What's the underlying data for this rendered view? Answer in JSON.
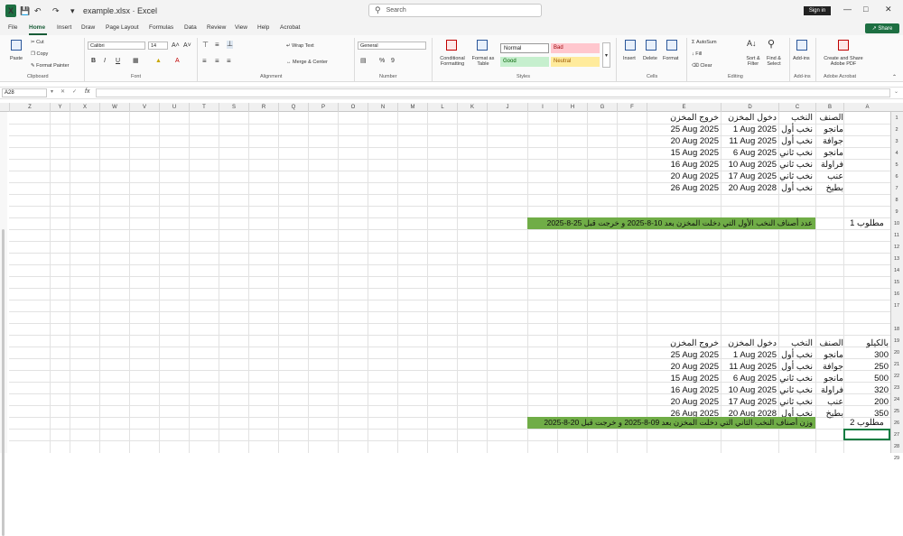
{
  "titlebar": {
    "app_icon": "X",
    "doc_title": "example.xlsx · Excel",
    "search_placeholder": "Search",
    "sign_in": "Sign in"
  },
  "menubar": {
    "tabs": [
      "File",
      "Home",
      "Insert",
      "Draw",
      "Page Layout",
      "Formulas",
      "Data",
      "Review",
      "View",
      "Help",
      "Acrobat"
    ],
    "share": "Share"
  },
  "ribbon": {
    "paste": "Paste",
    "cut": "Cut",
    "copy": "Copy",
    "format_painter": "Format Painter",
    "clipboard": "Clipboard",
    "font_name": "Calibri",
    "font_size": "14",
    "font_group": "Font",
    "wrap_text": "Wrap Text",
    "merge_center": "Merge & Center",
    "alignment": "Alignment",
    "number_format": "General",
    "number_group": "Number",
    "conditional": "Conditional Formatting",
    "format_table": "Format as Table",
    "style_normal": "Normal",
    "style_bad": "Bad",
    "style_good": "Good",
    "style_neutral": "Neutral",
    "styles_group": "Styles",
    "insert": "Insert",
    "delete": "Delete",
    "format": "Format",
    "cells_group": "Cells",
    "autosum": "AutoSum",
    "fill": "Fill",
    "clear": "Clear",
    "sort_filter": "Sort & Filter",
    "find_select": "Find & Select",
    "editing_group": "Editing",
    "addins": "Add-ins",
    "addins_group": "Add-ins",
    "create_share": "Create and Share Adobe PDF",
    "adobe_group": "Adobe Acrobat"
  },
  "formula": {
    "namebox": "A28",
    "fx": "fx"
  },
  "columns": [
    "Z",
    "Y",
    "X",
    "W",
    "V",
    "U",
    "T",
    "S",
    "R",
    "Q",
    "P",
    "O",
    "N",
    "M",
    "L",
    "K",
    "J",
    "I",
    "H",
    "G",
    "F",
    "E",
    "D",
    "C",
    "B",
    "A"
  ],
  "rows": [
    "1",
    "2",
    "3",
    "4",
    "5",
    "6",
    "7",
    "8",
    "9",
    "10",
    "11",
    "12",
    "13",
    "14",
    "15",
    "16",
    "17",
    "18",
    "19",
    "20",
    "21",
    "22",
    "23",
    "24",
    "25",
    "26",
    "27",
    "28",
    "29"
  ],
  "table1": {
    "headers": {
      "B": "الصنف",
      "C": "النخب",
      "D": "دخول المخزن",
      "E": "خروج المخزن"
    },
    "rows": [
      {
        "B": "مانجو",
        "C": "نخب أول",
        "D": "1 Aug 2025",
        "E": "25 Aug 2025"
      },
      {
        "B": "جوافة",
        "C": "نخب أول",
        "D": "11 Aug 2025",
        "E": "20 Aug 2025"
      },
      {
        "B": "مانجو",
        "C": "نخب ثاني",
        "D": "6 Aug 2025",
        "E": "15 Aug 2025"
      },
      {
        "B": "فراولة",
        "C": "نخب ثاني",
        "D": "10 Aug 2025",
        "E": "16 Aug 2025"
      },
      {
        "B": "عنب",
        "C": "نخب ثاني",
        "D": "17 Aug 2025",
        "E": "20 Aug 2025"
      },
      {
        "B": "بطيخ",
        "C": "نخب أول",
        "D": "20 Aug 2028",
        "E": "26 Aug 2025"
      }
    ]
  },
  "req1": {
    "label": "مطلوب 1",
    "text": "عدد أصناف النخب الأول التي دخلت المخزن بعد 10-8-2025 و خرجت قبل 25-8-2025"
  },
  "table2": {
    "headers": {
      "A": "بالكيلو",
      "B": "الصنف",
      "C": "النخب",
      "D": "دخول المخزن",
      "E": "خروج المخزن"
    },
    "rows": [
      {
        "A": "300",
        "B": "مانجو",
        "C": "نخب أول",
        "D": "1 Aug 2025",
        "E": "25 Aug 2025"
      },
      {
        "A": "250",
        "B": "جوافة",
        "C": "نخب أول",
        "D": "11 Aug 2025",
        "E": "20 Aug 2025"
      },
      {
        "A": "500",
        "B": "مانجو",
        "C": "نخب ثاني",
        "D": "6 Aug 2025",
        "E": "15 Aug 2025"
      },
      {
        "A": "320",
        "B": "فراولة",
        "C": "نخب ثاني",
        "D": "10 Aug 2025",
        "E": "16 Aug 2025"
      },
      {
        "A": "200",
        "B": "عنب",
        "C": "نخب ثاني",
        "D": "17 Aug 2025",
        "E": "20 Aug 2025"
      },
      {
        "A": "350",
        "B": "بطيخ",
        "C": "نخب أول",
        "D": "20 Aug 2028",
        "E": "26 Aug 2025"
      }
    ]
  },
  "req2": {
    "label": "مطلوب 2",
    "text": "وزن أصناف النخب الثاني التي دخلت المخزن بعد 09-8-2025 و خرجت قبل 20-8-2025"
  }
}
